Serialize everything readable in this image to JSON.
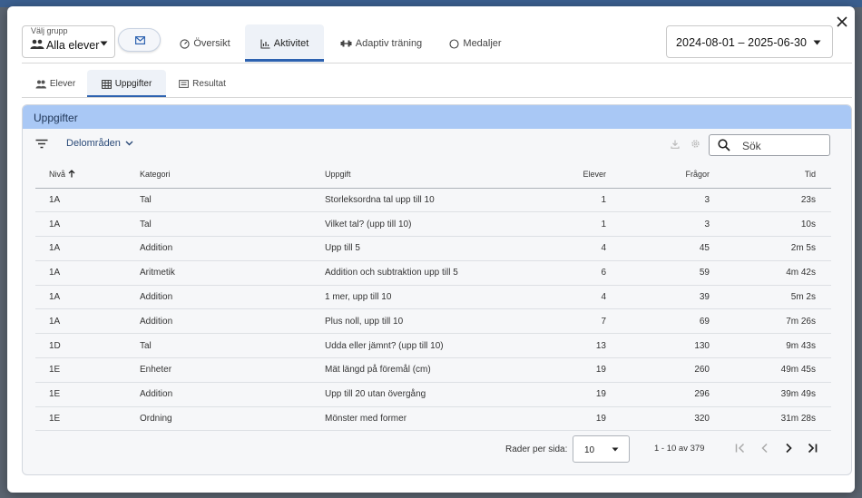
{
  "group": {
    "label": "Välj grupp",
    "value": "Alla elever"
  },
  "tabs": [
    {
      "label": "Översikt"
    },
    {
      "label": "Aktivitet"
    },
    {
      "label": "Adaptiv träning"
    },
    {
      "label": "Medaljer"
    }
  ],
  "date_range": "2024-08-01 – 2025-06-30",
  "subtabs": [
    {
      "label": "Elever"
    },
    {
      "label": "Uppgifter"
    },
    {
      "label": "Resultat"
    }
  ],
  "card": {
    "title": "Uppgifter",
    "filter_label": "Delområden",
    "search_placeholder": "Sök"
  },
  "table": {
    "headers": {
      "level": "Nivå",
      "category": "Kategori",
      "task": "Uppgift",
      "students": "Elever",
      "questions": "Frågor",
      "time": "Tid"
    },
    "rows": [
      {
        "level": "1A",
        "category": "Tal",
        "task": "Storleksordna tal upp till 10",
        "students": "1",
        "questions": "3",
        "time": "23s"
      },
      {
        "level": "1A",
        "category": "Tal",
        "task": "Vilket tal? (upp till 10)",
        "students": "1",
        "questions": "3",
        "time": "10s"
      },
      {
        "level": "1A",
        "category": "Addition",
        "task": "Upp till 5",
        "students": "4",
        "questions": "45",
        "time": "2m 5s"
      },
      {
        "level": "1A",
        "category": "Aritmetik",
        "task": "Addition och subtraktion upp till 5",
        "students": "6",
        "questions": "59",
        "time": "4m 42s"
      },
      {
        "level": "1A",
        "category": "Addition",
        "task": "1 mer, upp till 10",
        "students": "4",
        "questions": "39",
        "time": "5m 2s"
      },
      {
        "level": "1A",
        "category": "Addition",
        "task": "Plus noll, upp till 10",
        "students": "7",
        "questions": "69",
        "time": "7m 26s"
      },
      {
        "level": "1D",
        "category": "Tal",
        "task": "Udda eller jämnt? (upp till 10)",
        "students": "13",
        "questions": "130",
        "time": "9m 43s"
      },
      {
        "level": "1E",
        "category": "Enheter",
        "task": "Mät längd på föremål (cm)",
        "students": "19",
        "questions": "260",
        "time": "49m 45s"
      },
      {
        "level": "1E",
        "category": "Addition",
        "task": "Upp till 20 utan övergång",
        "students": "19",
        "questions": "296",
        "time": "39m 49s"
      },
      {
        "level": "1E",
        "category": "Ordning",
        "task": "Mönster med former",
        "students": "19",
        "questions": "320",
        "time": "31m 28s"
      }
    ]
  },
  "pagination": {
    "rows_per_page_label": "Rader per sida:",
    "rows_per_page": "10",
    "range": "1 - 10 av 379"
  }
}
